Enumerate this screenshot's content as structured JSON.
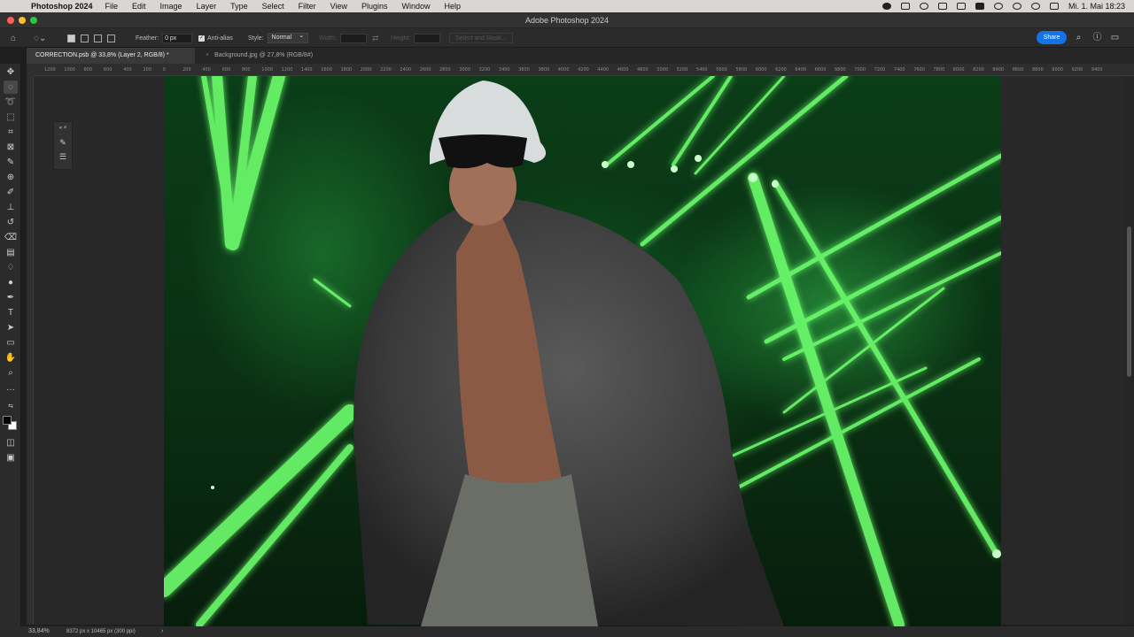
{
  "menubar": {
    "app_name": "Photoshop 2024",
    "menus": [
      "File",
      "Edit",
      "Image",
      "Layer",
      "Type",
      "Select",
      "Filter",
      "View",
      "Plugins",
      "Window",
      "Help"
    ],
    "datetime": "Mi. 1. Mai 18:23"
  },
  "window": {
    "title": "Adobe Photoshop 2024"
  },
  "options": {
    "feather_label": "Feather:",
    "feather_value": "0 px",
    "antialias_label": "Anti-alias",
    "style_label": "Style:",
    "style_value": "Normal",
    "width_label": "Width:",
    "height_label": "Height:",
    "select_mask_label": "Select and Mask...",
    "share_label": "Share"
  },
  "tabs": [
    {
      "label": "CORRECTION.psb @ 33,8% (Layer 2, RGB/8) *",
      "active": true
    },
    {
      "label": "Background.jpg @ 27,8% (RGB/8#)",
      "active": false
    }
  ],
  "ruler": {
    "ticks": [
      "1200",
      "1000",
      "800",
      "600",
      "400",
      "200",
      "0",
      "200",
      "400",
      "600",
      "800",
      "1000",
      "1200",
      "1400",
      "1600",
      "1800",
      "2000",
      "2200",
      "2400",
      "2600",
      "2800",
      "3000",
      "3200",
      "3400",
      "3600",
      "3800",
      "4000",
      "4200",
      "4400",
      "4600",
      "4800",
      "5000",
      "5200",
      "5400",
      "5600",
      "5800",
      "6000",
      "6200",
      "6400",
      "6600",
      "6800",
      "7000",
      "7200",
      "7400",
      "7600",
      "7800",
      "8000",
      "8200",
      "8400",
      "8600",
      "8800",
      "9000",
      "9200",
      "9400"
    ]
  },
  "status": {
    "zoom": "33,84%",
    "doc_info": "8372 px x 10465 px (300 ppi)"
  },
  "colors": {
    "accent": "#1473e6",
    "foreground": "#000000",
    "background": "#ffffff",
    "traffic_red": "#ff5f57",
    "traffic_yellow": "#febc2e",
    "traffic_green": "#28c840"
  }
}
